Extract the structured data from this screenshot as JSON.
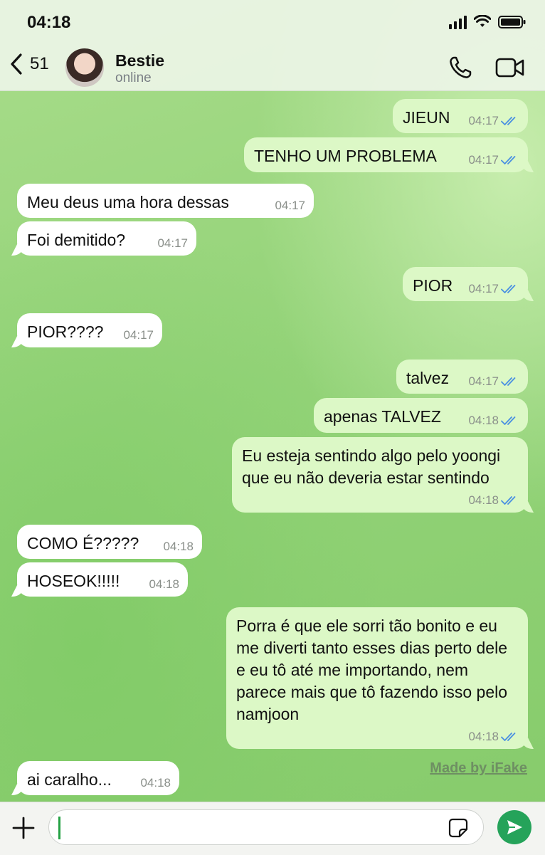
{
  "status_bar": {
    "time": "04:18"
  },
  "header": {
    "back_count": "51",
    "contact_name": "Bestie",
    "contact_status": "online"
  },
  "messages": [
    {
      "dir": "out",
      "text": "JIEUN",
      "time": "04:17",
      "read": true
    },
    {
      "dir": "out",
      "text": "TENHO UM PROBLEMA",
      "time": "04:17",
      "read": true
    },
    {
      "dir": "in",
      "text": "Meu deus uma hora dessas",
      "time": "04:17"
    },
    {
      "dir": "in",
      "text": "Foi demitido?",
      "time": "04:17"
    },
    {
      "dir": "out",
      "text": "PIOR",
      "time": "04:17",
      "read": true
    },
    {
      "dir": "in",
      "text": "PIOR????",
      "time": "04:17"
    },
    {
      "dir": "out",
      "text": "talvez",
      "time": "04:17",
      "read": true
    },
    {
      "dir": "out",
      "text": "apenas TALVEZ",
      "time": "04:18",
      "read": true
    },
    {
      "dir": "out",
      "text": "Eu esteja sentindo algo pelo yoongi que eu não deveria estar sentindo",
      "time": "04:18",
      "read": true
    },
    {
      "dir": "in",
      "text": "COMO É?????",
      "time": "04:18"
    },
    {
      "dir": "in",
      "text": "HOSEOK!!!!!",
      "time": "04:18"
    },
    {
      "dir": "out",
      "text": "Porra é que ele sorri tão bonito e eu me diverti tanto esses dias perto dele e eu tô até me importando, nem parece mais que tô fazendo isso pelo namjoon",
      "time": "04:18",
      "read": true
    },
    {
      "dir": "in",
      "text": "ai caralho...",
      "time": "04:18"
    }
  ],
  "watermark": "Made by iFake",
  "composer": {
    "value": "",
    "placeholder": ""
  },
  "colors": {
    "outgoing_bubble": "#dcf8c6",
    "incoming_bubble": "#ffffff",
    "read_ticks": "#4a90e2",
    "send_button": "#25a35a"
  }
}
